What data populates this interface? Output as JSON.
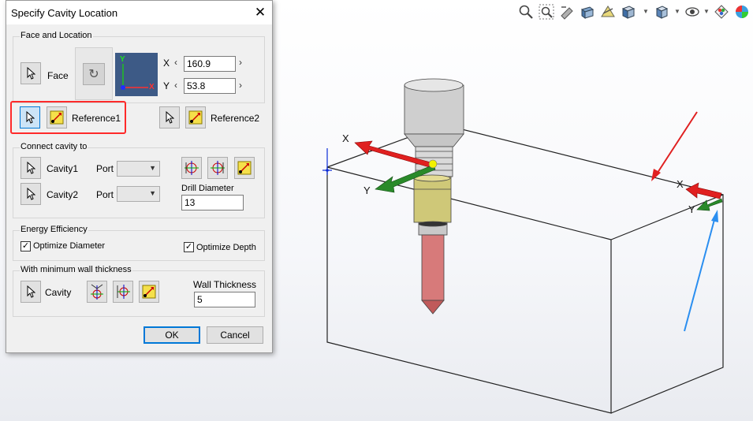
{
  "dialog": {
    "title": "Specify Cavity Location",
    "face_location": {
      "group_label": "Face and Location",
      "face_label": "Face",
      "x_label": "X",
      "x_value": "160.9",
      "y_label": "Y",
      "y_value": "53.8",
      "reference1_label": "Reference1",
      "reference2_label": "Reference2",
      "preview_axis_y": "Y",
      "preview_axis_x": "X"
    },
    "connect": {
      "group_label": "Connect cavity to",
      "cavity1_label": "Cavity1",
      "cavity2_label": "Cavity2",
      "port_label": "Port",
      "drill_diameter_label": "Drill Diameter",
      "drill_diameter_value": "13"
    },
    "energy": {
      "group_label": "Energy Efficiency",
      "optimize_diameter_label": "Optimize Diameter",
      "optimize_diameter_checked": true,
      "optimize_depth_label": "Optimize Depth",
      "optimize_depth_checked": true
    },
    "wall": {
      "group_label": "With minimum wall thickness",
      "cavity_label": "Cavity",
      "wall_thickness_label": "Wall Thickness",
      "wall_thickness_value": "5"
    },
    "ok_label": "OK",
    "cancel_label": "Cancel"
  },
  "viewport": {
    "triad_labels": {
      "x": "X",
      "y": "Y"
    },
    "corner_labels": {
      "x": "X",
      "y": "Y"
    },
    "toolbar_icons": [
      "zoom-to-fit-icon",
      "zoom-area-icon",
      "previous-view-icon",
      "section-view-icon",
      "dynamic-annotation-icon",
      "view-orientation-icon",
      "display-style-icon",
      "hide-show-icon",
      "edit-appearance-icon",
      "apply-scene-icon"
    ]
  },
  "colors": {
    "accent": "#0078d7",
    "highlight_box": "#ff2a2a",
    "red_arrow": "#e02020",
    "green_arrow": "#2a8a2a",
    "blue_arrow": "#2a8ef0"
  }
}
